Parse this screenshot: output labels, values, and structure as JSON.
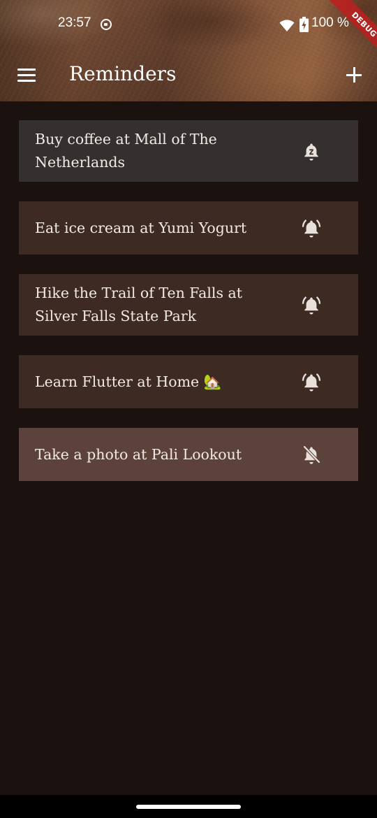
{
  "status_bar": {
    "time": "23:57",
    "battery": "100 %"
  },
  "debug_banner": "DEBUG",
  "app_bar": {
    "title": "Reminders",
    "menu_icon": "menu-icon",
    "add_icon": "add-icon"
  },
  "reminders": [
    {
      "text": "Buy coffee at Mall of The Netherlands",
      "state": "snoozed",
      "icon": "snooze-bell-icon",
      "background": "#353030"
    },
    {
      "text": "Eat ice cream at Yumi Yogurt",
      "state": "active",
      "icon": "alarm-active-icon",
      "background": "#3d2a22"
    },
    {
      "text": "Hike the Trail of Ten Falls at Silver Falls State Park",
      "state": "active",
      "icon": "alarm-active-icon",
      "background": "#3d2a22"
    },
    {
      "text": "Learn Flutter at Home 🏡",
      "state": "active",
      "icon": "alarm-active-icon",
      "background": "#3d2a22"
    },
    {
      "text": "Take a photo at Pali Lookout",
      "state": "disabled",
      "icon": "alarm-off-icon",
      "background": "#5c423a"
    }
  ],
  "colors": {
    "background": "#1b1210",
    "active_card": "#3d2a22",
    "snoozed_card": "#353030",
    "disabled_card": "#5c423a",
    "text": "#f1e9e3"
  }
}
